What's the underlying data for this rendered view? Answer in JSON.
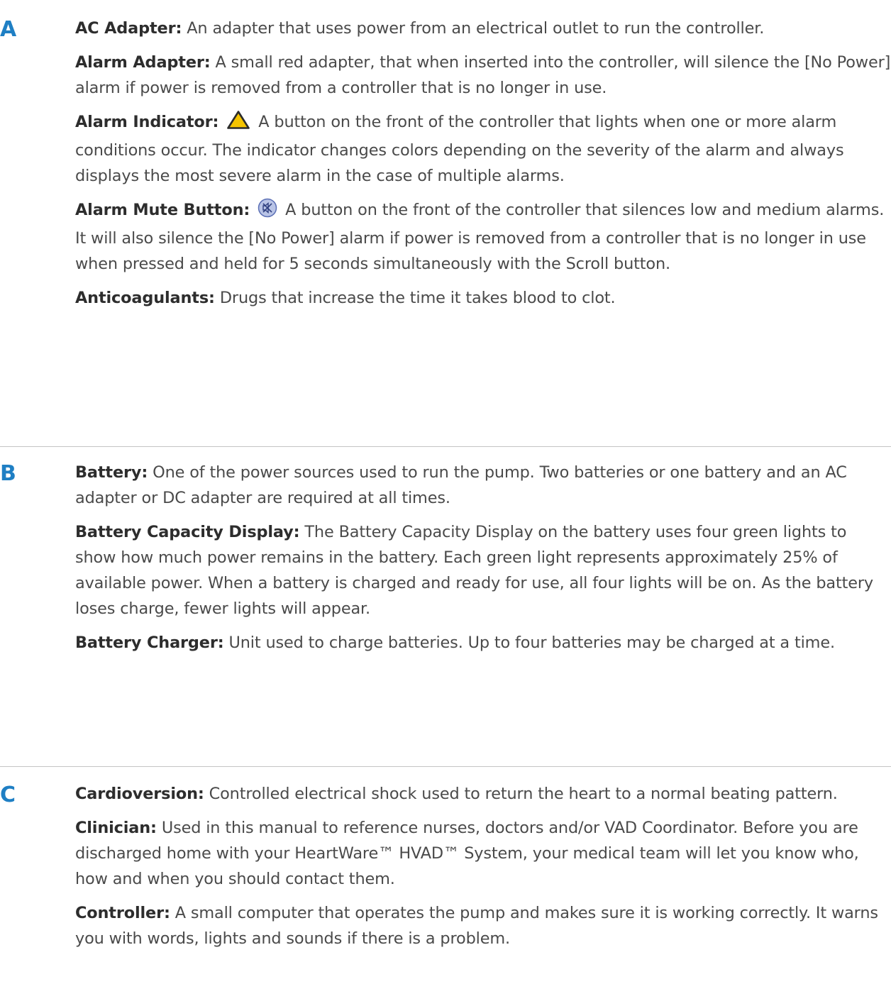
{
  "sections": [
    {
      "letter": "A",
      "entries": [
        {
          "term": "AC Adapter:",
          "def": "An adapter that uses power from an electrical outlet to run the controller."
        },
        {
          "term": "Alarm Adapter:",
          "def": "A small red adapter, that when inserted into the controller, will silence the [No Power] alarm if power is removed from a controller that is no longer in use."
        },
        {
          "term": "Alarm Indicator:",
          "icon": "warning-triangle-icon",
          "def": "A button on the front of the controller that lights when one or more alarm conditions occur. The indicator changes colors depending on the severity of the alarm and always displays the most severe alarm in the case of multiple alarms."
        },
        {
          "term": "Alarm Mute Button:",
          "icon": "alarm-mute-icon",
          "def": "A button on the front of the controller that silences low and medium alarms. It will also silence the [No Power] alarm if power is removed from a controller that is no longer in use when pressed and held for 5 seconds simultaneously with the Scroll button."
        },
        {
          "term": "Anticoagulants:",
          "def": "Drugs that increase the time it takes blood to clot."
        }
      ]
    },
    {
      "letter": "B",
      "entries": [
        {
          "term": "Battery:",
          "def": "One of the power sources used to run the pump. Two batteries or one battery and an AC adapter or DC adapter are required at all times."
        },
        {
          "term": "Battery Capacity Display:",
          "def": "The Battery Capacity Display on the battery uses four green lights to show how much power remains in the battery. Each green light represents approximately 25% of available power. When a battery is charged and ready for use, all four lights will be on. As the battery loses charge, fewer lights will appear."
        },
        {
          "term": "Battery Charger:",
          "def": "Unit used to charge batteries. Up to four batteries may be charged at a time."
        }
      ]
    },
    {
      "letter": "C",
      "entries": [
        {
          "term": "Cardioversion:",
          "def": "Controlled electrical shock used to return the heart to a normal beating pattern."
        },
        {
          "term": "Clinician:",
          "def": "Used in this manual to reference nurses, doctors and/or VAD Coordinator. Before you are discharged home with your HeartWare™ HVAD™ System, your medical team will let you know who, how and when you should contact them."
        },
        {
          "term": "Controller:",
          "def": "A small computer that operates the pump and makes sure it is working correctly. It warns you with words, lights and sounds if there is a problem."
        }
      ]
    }
  ],
  "colors": {
    "letter": "#1f7fc4",
    "warning_icon_fill": "#f5c400",
    "mute_icon_fill": "#b9c4e6"
  }
}
